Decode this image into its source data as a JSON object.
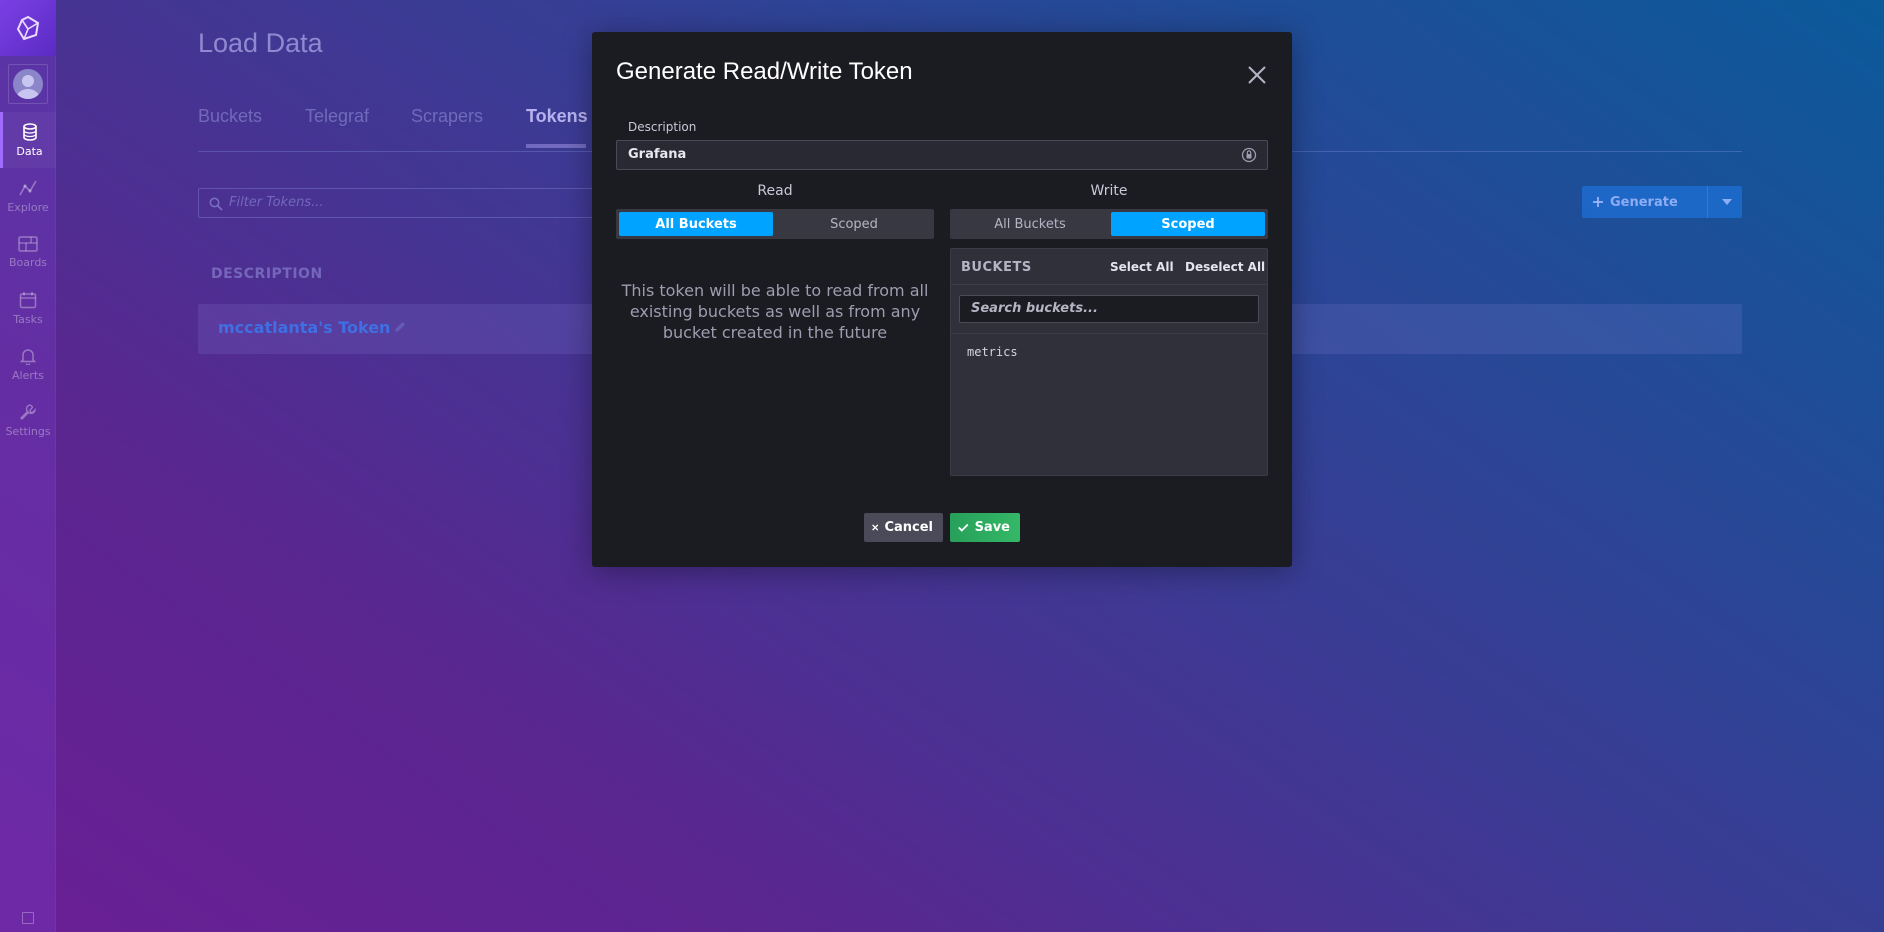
{
  "sidebar": {
    "items": [
      {
        "label": "Data",
        "icon": "database-icon",
        "active": true
      },
      {
        "label": "Explore",
        "icon": "graph-icon",
        "active": false
      },
      {
        "label": "Boards",
        "icon": "dashboard-icon",
        "active": false
      },
      {
        "label": "Tasks",
        "icon": "calendar-icon",
        "active": false
      },
      {
        "label": "Alerts",
        "icon": "bell-icon",
        "active": false
      },
      {
        "label": "Settings",
        "icon": "wrench-icon",
        "active": false
      }
    ]
  },
  "page": {
    "title": "Load Data",
    "tabs": [
      {
        "label": "Buckets",
        "active": false
      },
      {
        "label": "Telegraf",
        "active": false
      },
      {
        "label": "Scrapers",
        "active": false
      },
      {
        "label": "Tokens",
        "active": true
      }
    ],
    "filter_placeholder": "Filter Tokens...",
    "generate_label": "Generate",
    "column_header": "DESCRIPTION",
    "tokens": [
      {
        "name": "mccatlanta's Token"
      }
    ]
  },
  "modal": {
    "title": "Generate Read/Write Token",
    "description_label": "Description",
    "description_value": "Grafana",
    "read": {
      "heading": "Read",
      "options": [
        "All Buckets",
        "Scoped"
      ],
      "selected": "All Buckets",
      "note": "This token will be able to read from all existing buckets as well as from any bucket created in the future"
    },
    "write": {
      "heading": "Write",
      "options": [
        "All Buckets",
        "Scoped"
      ],
      "selected": "Scoped",
      "panel_title": "BUCKETS",
      "select_all": "Select All",
      "deselect_all": "Deselect All",
      "search_placeholder": "Search buckets...",
      "buckets": [
        "metrics"
      ]
    },
    "cancel_label": "Cancel",
    "save_label": "Save"
  },
  "colors": {
    "accent_blue": "#00a3ff",
    "save_green": "#34b866",
    "modal_bg": "#1b1b22"
  }
}
